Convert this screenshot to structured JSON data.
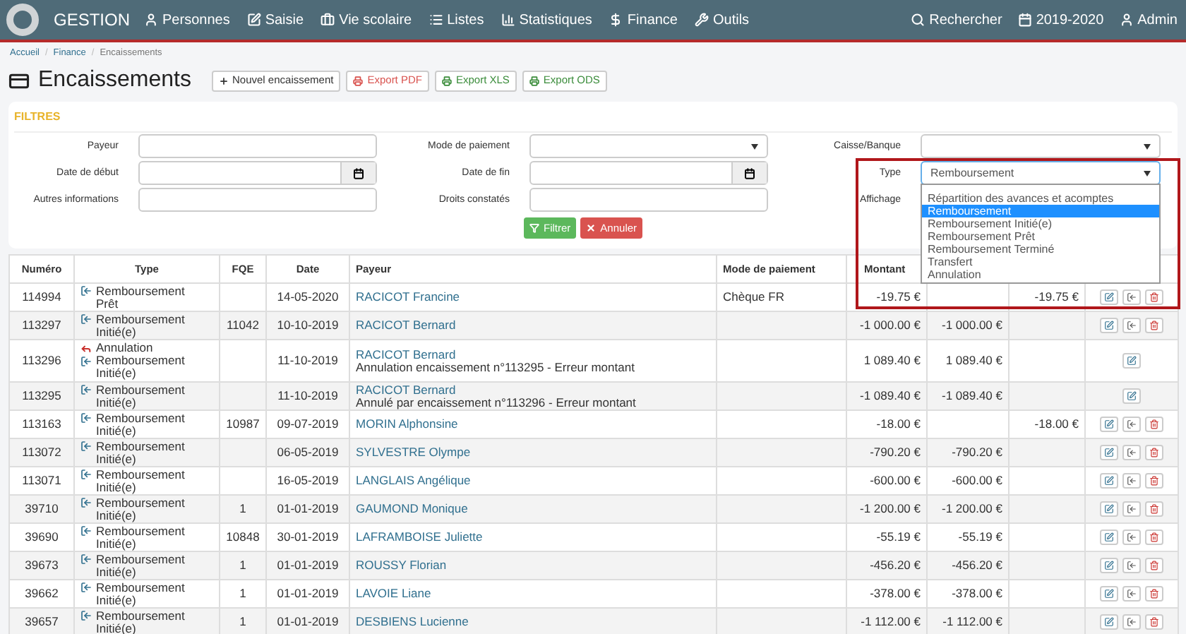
{
  "navbar": {
    "brand": "GESTION",
    "items": [
      "Personnes",
      "Saisie",
      "Vie scolaire",
      "Listes",
      "Statistiques",
      "Finance",
      "Outils"
    ],
    "right_items": [
      "Rechercher",
      "2019-2020",
      "Admin"
    ]
  },
  "breadcrumb": [
    {
      "label": "Accueil",
      "link": true
    },
    {
      "separator": "/",
      "label": "Finance",
      "link": true
    },
    {
      "separator": "/",
      "label": "Encaissements",
      "link": false
    }
  ],
  "page_title": "Encaissements",
  "toolbar_buttons": [
    {
      "label": "Nouvel encaissement",
      "kind": "new"
    },
    {
      "label": "Export PDF",
      "kind": "pdf"
    },
    {
      "label": "Export XLS",
      "kind": "xls"
    },
    {
      "label": "Export ODS",
      "kind": "ods"
    }
  ],
  "filters": {
    "title": "FILTRES",
    "fields": [
      {
        "label": "Payeur",
        "kind": "text"
      },
      {
        "label": "Mode de paiement",
        "kind": "select",
        "expanded": false
      },
      {
        "label": "Caisse/Banque",
        "kind": "select",
        "expanded": false
      },
      {
        "label": "Date de début",
        "kind": "date"
      },
      {
        "label": "Date de fin",
        "kind": "date"
      },
      {
        "label": "Type",
        "kind": "select",
        "expanded": true,
        "value": "Remboursement",
        "options": [
          {
            "label": "Répartition des avances et acomptes",
            "selected": false
          },
          {
            "label": "Remboursement",
            "selected": true
          },
          {
            "label": "Remboursement Initié(e)",
            "selected": false
          },
          {
            "label": "Remboursement Prêt",
            "selected": false
          },
          {
            "label": "Remboursement Terminé",
            "selected": false
          },
          {
            "label": "Transfert",
            "selected": false
          },
          {
            "label": "Annulation",
            "selected": false
          }
        ]
      },
      {
        "label": "Autres informations",
        "kind": "text"
      },
      {
        "label": "Droits constatés",
        "kind": "text"
      },
      {
        "label": "Affichage"
      }
    ],
    "buttons": [
      {
        "label": "Filtrer",
        "kind": "filter"
      },
      {
        "label": "Annuler",
        "kind": "cancel"
      }
    ]
  },
  "table": {
    "columns": [
      "Numéro",
      "Type",
      "FQE",
      "Date",
      "Payeur",
      "Mode de paiement",
      "Montant"
    ],
    "rows": [
      {
        "numero": "114994",
        "type": [
          {
            "kind": "refund",
            "label": "Remboursement Prêt"
          }
        ],
        "fqe": "",
        "date": "14-05-2020",
        "payeur": "RACICOT Francine",
        "mode": "Chèque FR",
        "montant": "-19.75 €",
        "column_7": "",
        "column_8": "-19.75 €",
        "actions": [
          {
            "kind": "edit"
          },
          {
            "kind": "transfer"
          },
          {
            "kind": "delete"
          }
        ]
      },
      {
        "numero": "113297",
        "type": [
          {
            "kind": "refund",
            "label": "Remboursement Initié(e)"
          }
        ],
        "fqe": "11042",
        "date": "10-10-2019",
        "payeur": "RACICOT Bernard",
        "mode": "",
        "montant": "-1 000.00 €",
        "column_7": "-1 000.00 €",
        "column_8": "",
        "actions": [
          {
            "kind": "edit"
          },
          {
            "kind": "transfer"
          },
          {
            "kind": "delete"
          }
        ]
      },
      {
        "numero": "113296",
        "type": [
          {
            "kind": "cancel",
            "label": "Annulation"
          },
          {
            "kind": "refund",
            "label": "Remboursement Initié(e)"
          }
        ],
        "fqe": "",
        "date": "11-10-2019",
        "payeur": "RACICOT Bernard",
        "note": "Annulation encaissement n°113295 - Erreur montant",
        "mode": "",
        "montant": "1 089.40 €",
        "column_7": "1 089.40 €",
        "column_8": "",
        "actions": [
          {
            "kind": "edit"
          }
        ]
      },
      {
        "numero": "113295",
        "type": [
          {
            "kind": "refund",
            "label": "Remboursement Initié(e)"
          }
        ],
        "fqe": "",
        "date": "11-10-2019",
        "payeur": "RACICOT Bernard",
        "note": "Annulé par encaissement n°113296 - Erreur montant",
        "mode": "",
        "montant": "-1 089.40 €",
        "column_7": "-1 089.40 €",
        "column_8": "",
        "actions": [
          {
            "kind": "edit"
          }
        ]
      },
      {
        "numero": "113163",
        "type": [
          {
            "kind": "refund",
            "label": "Remboursement Initié(e)"
          }
        ],
        "fqe": "10987",
        "date": "09-07-2019",
        "payeur": "MORIN Alphonsine",
        "mode": "",
        "montant": "-18.00 €",
        "column_7": "",
        "column_8": "-18.00 €",
        "actions": [
          {
            "kind": "edit"
          },
          {
            "kind": "transfer"
          },
          {
            "kind": "delete"
          }
        ]
      },
      {
        "numero": "113072",
        "type": [
          {
            "kind": "refund",
            "label": "Remboursement Initié(e)"
          }
        ],
        "fqe": "",
        "date": "06-05-2019",
        "payeur": "SYLVESTRE Olympe",
        "mode": "",
        "montant": "-790.20 €",
        "column_7": "-790.20 €",
        "column_8": "",
        "actions": [
          {
            "kind": "edit"
          },
          {
            "kind": "transfer"
          },
          {
            "kind": "delete"
          }
        ]
      },
      {
        "numero": "113071",
        "type": [
          {
            "kind": "refund",
            "label": "Remboursement Initié(e)"
          }
        ],
        "fqe": "",
        "date": "16-05-2019",
        "payeur": "LANGLAIS Angélique",
        "mode": "",
        "montant": "-600.00 €",
        "column_7": "-600.00 €",
        "column_8": "",
        "actions": [
          {
            "kind": "edit"
          },
          {
            "kind": "transfer"
          },
          {
            "kind": "delete"
          }
        ]
      },
      {
        "numero": "39710",
        "type": [
          {
            "kind": "refund",
            "label": "Remboursement Initié(e)"
          }
        ],
        "fqe": "1",
        "date": "01-01-2019",
        "payeur": "GAUMOND Monique",
        "mode": "",
        "montant": "-1 200.00 €",
        "column_7": "-1 200.00 €",
        "column_8": "",
        "actions": [
          {
            "kind": "edit"
          },
          {
            "kind": "transfer"
          },
          {
            "kind": "delete"
          }
        ]
      },
      {
        "numero": "39690",
        "type": [
          {
            "kind": "refund",
            "label": "Remboursement Initié(e)"
          }
        ],
        "fqe": "10848",
        "date": "30-01-2019",
        "payeur": "LAFRAMBOISE Juliette",
        "mode": "",
        "montant": "-55.19 €",
        "column_7": "-55.19 €",
        "column_8": "",
        "actions": [
          {
            "kind": "edit"
          },
          {
            "kind": "transfer"
          },
          {
            "kind": "delete"
          }
        ]
      },
      {
        "numero": "39673",
        "type": [
          {
            "kind": "refund",
            "label": "Remboursement Initié(e)"
          }
        ],
        "fqe": "1",
        "date": "01-01-2019",
        "payeur": "ROUSSY Florian",
        "mode": "",
        "montant": "-456.20 €",
        "column_7": "-456.20 €",
        "column_8": "",
        "actions": [
          {
            "kind": "edit"
          },
          {
            "kind": "transfer"
          },
          {
            "kind": "delete"
          }
        ]
      },
      {
        "numero": "39662",
        "type": [
          {
            "kind": "refund",
            "label": "Remboursement Initié(e)"
          }
        ],
        "fqe": "1",
        "date": "01-01-2019",
        "payeur": "LAVOIE Liane",
        "mode": "",
        "montant": "-378.00 €",
        "column_7": "-378.00 €",
        "column_8": "",
        "actions": [
          {
            "kind": "edit"
          },
          {
            "kind": "transfer"
          },
          {
            "kind": "delete"
          }
        ]
      },
      {
        "numero": "39657",
        "type": [
          {
            "kind": "refund",
            "label": "Remboursement Initié(e)"
          }
        ],
        "fqe": "1",
        "date": "01-01-2019",
        "payeur": "DESBIENS Lucienne",
        "mode": "",
        "montant": "-1 112.00 €",
        "column_7": "-1 112.00 €",
        "column_8": "",
        "actions": [
          {
            "kind": "edit"
          },
          {
            "kind": "transfer"
          },
          {
            "kind": "delete"
          }
        ]
      }
    ]
  }
}
